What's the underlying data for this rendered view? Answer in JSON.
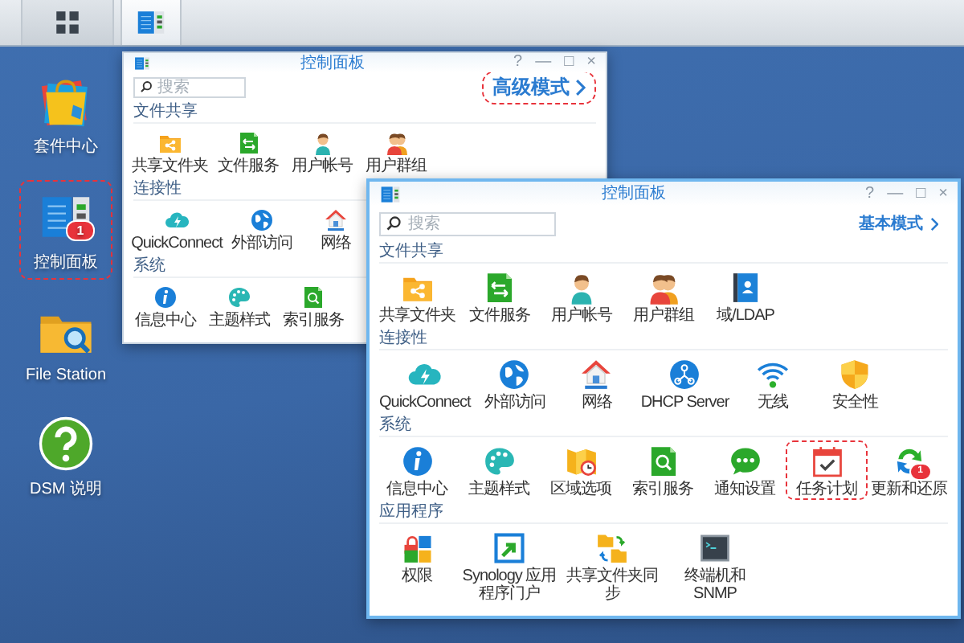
{
  "taskbar": {
    "buttons": [
      {
        "kind": "main-menu",
        "selected": false
      },
      {
        "kind": "control-panel",
        "selected": true
      }
    ]
  },
  "desktop_icons": [
    {
      "label": "套件中心",
      "kind": "package-center",
      "highlighted": false
    },
    {
      "label": "控制面板",
      "kind": "control-panel",
      "badge": "1",
      "highlighted": true
    },
    {
      "label": "File Station",
      "kind": "file-station",
      "highlighted": false
    },
    {
      "label": "DSM 说明",
      "kind": "help",
      "highlighted": false
    }
  ],
  "back_window": {
    "title": "控制面板",
    "controls": [
      "?",
      "—",
      "□",
      "×"
    ],
    "search": {
      "placeholder": "搜索"
    },
    "mode_link": {
      "label": "高级模式",
      "highlighted": true
    },
    "sections": [
      {
        "title": "文件共享",
        "items": [
          {
            "label": "共享文件夹",
            "kind": "shared-folder"
          },
          {
            "label": "文件服务",
            "kind": "file-services"
          },
          {
            "label": "用户帐号",
            "kind": "user"
          },
          {
            "label": "用户群组",
            "kind": "group"
          }
        ]
      },
      {
        "title": "连接性",
        "items": [
          {
            "label": "QuickConnect",
            "kind": "quickconnect"
          },
          {
            "label": "外部访问",
            "kind": "external-access"
          },
          {
            "label": "网络",
            "kind": "network"
          }
        ]
      },
      {
        "title": "系统",
        "items": [
          {
            "label": "信息中心",
            "kind": "info"
          },
          {
            "label": "主题样式",
            "kind": "theme"
          },
          {
            "label": "索引服务",
            "kind": "indexing"
          }
        ]
      }
    ]
  },
  "front_window": {
    "title": "控制面板",
    "controls": [
      "?",
      "—",
      "□",
      "×"
    ],
    "search": {
      "placeholder": "搜索"
    },
    "mode_link": {
      "label": "基本模式",
      "highlighted": false
    },
    "sections": [
      {
        "title": "文件共享",
        "items": [
          {
            "label": "共享文件夹",
            "kind": "shared-folder"
          },
          {
            "label": "文件服务",
            "kind": "file-services"
          },
          {
            "label": "用户帐号",
            "kind": "user"
          },
          {
            "label": "用户群组",
            "kind": "group"
          },
          {
            "label": "域/LDAP",
            "kind": "ldap"
          }
        ]
      },
      {
        "title": "连接性",
        "items": [
          {
            "label": "QuickConnect",
            "kind": "quickconnect"
          },
          {
            "label": "外部访问",
            "kind": "external-access"
          },
          {
            "label": "网络",
            "kind": "network"
          },
          {
            "label": "DHCP Server",
            "kind": "dhcp"
          },
          {
            "label": "无线",
            "kind": "wireless"
          },
          {
            "label": "安全性",
            "kind": "security"
          }
        ]
      },
      {
        "title": "系统",
        "items": [
          {
            "label": "信息中心",
            "kind": "info"
          },
          {
            "label": "主题样式",
            "kind": "theme"
          },
          {
            "label": "区域选项",
            "kind": "region"
          },
          {
            "label": "索引服务",
            "kind": "indexing"
          },
          {
            "label": "通知设置",
            "kind": "notification"
          },
          {
            "label": "任务计划",
            "kind": "task-scheduler",
            "highlighted": true
          },
          {
            "label": "更新和还原",
            "kind": "update",
            "badge": "1"
          }
        ]
      },
      {
        "title": "应用程序",
        "items": [
          {
            "label": "权限",
            "kind": "privileges"
          },
          {
            "label": "Synology 应用程序门户",
            "kind": "app-portal"
          },
          {
            "label": "共享文件夹同步",
            "kind": "folder-sync"
          },
          {
            "label": "终端机和 SNMP",
            "kind": "terminal"
          }
        ]
      }
    ]
  }
}
